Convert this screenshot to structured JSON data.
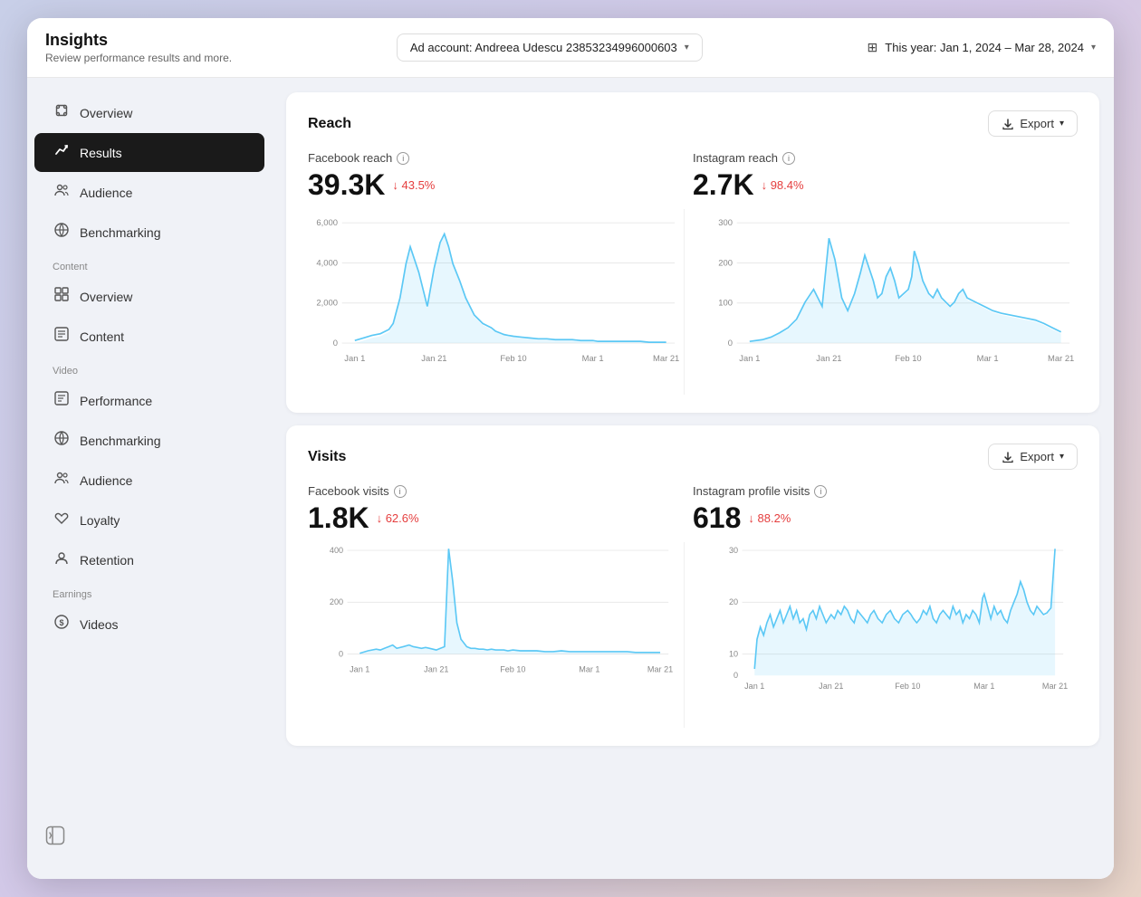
{
  "app": {
    "title": "Insights",
    "subtitle": "Review performance results and more."
  },
  "adAccount": {
    "label": "Ad account: Andreea Udescu 23853234996000603",
    "chevron": "▾"
  },
  "dateRange": {
    "label": "This year: Jan 1, 2024 – Mar 28, 2024",
    "chevron": "▾"
  },
  "sidebar": {
    "items": [
      {
        "id": "overview",
        "label": "Overview",
        "icon": "❊"
      },
      {
        "id": "results",
        "label": "Results",
        "icon": "↗",
        "active": true
      },
      {
        "id": "audience",
        "label": "Audience",
        "icon": "👥"
      },
      {
        "id": "benchmarking",
        "label": "Benchmarking",
        "icon": "⚖"
      }
    ],
    "contentSection": "Content",
    "contentItems": [
      {
        "id": "content-overview",
        "label": "Overview",
        "icon": "▦"
      },
      {
        "id": "content-content",
        "label": "Content",
        "icon": "☰"
      }
    ],
    "videoSection": "Video",
    "videoItems": [
      {
        "id": "video-performance",
        "label": "Performance",
        "icon": "▤"
      },
      {
        "id": "video-benchmarking",
        "label": "Benchmarking",
        "icon": "⚖"
      },
      {
        "id": "video-audience",
        "label": "Audience",
        "icon": "👥"
      },
      {
        "id": "video-loyalty",
        "label": "Loyalty",
        "icon": "🛡"
      },
      {
        "id": "video-retention",
        "label": "Retention",
        "icon": "👤"
      }
    ],
    "earningsSection": "Earnings",
    "earningsItems": [
      {
        "id": "earnings-videos",
        "label": "Videos",
        "icon": "💲"
      }
    ],
    "bottomIcon": "⊞"
  },
  "reach": {
    "cardTitle": "Reach",
    "exportLabel": "Export",
    "facebook": {
      "label": "Facebook reach",
      "value": "39.3K",
      "change": "↓ 43.5%",
      "changeDir": "down"
    },
    "instagram": {
      "label": "Instagram reach",
      "value": "2.7K",
      "change": "↓ 98.4%",
      "changeDir": "down"
    },
    "fbChart": {
      "yLabels": [
        "6,000",
        "4,000",
        "2,000",
        "0"
      ],
      "xLabels": [
        "Jan 1",
        "Jan 21",
        "Feb 10",
        "Mar 1",
        "Mar 21"
      ]
    },
    "igChart": {
      "yLabels": [
        "300",
        "200",
        "100",
        "0"
      ],
      "xLabels": [
        "Jan 1",
        "Jan 21",
        "Feb 10",
        "Mar 1",
        "Mar 21"
      ]
    }
  },
  "visits": {
    "cardTitle": "Visits",
    "exportLabel": "Export",
    "facebook": {
      "label": "Facebook visits",
      "value": "1.8K",
      "change": "↓ 62.6%",
      "changeDir": "down"
    },
    "instagram": {
      "label": "Instagram profile visits",
      "value": "618",
      "change": "↓ 88.2%",
      "changeDir": "down"
    },
    "fbChart": {
      "yLabels": [
        "400",
        "200",
        "0"
      ],
      "xLabels": [
        "Jan 1",
        "Jan 21",
        "Feb 10",
        "Mar 1",
        "Mar 21"
      ]
    },
    "igChart": {
      "yLabels": [
        "30",
        "20",
        "10",
        "0"
      ],
      "xLabels": [
        "Jan 1",
        "Jan 21",
        "Feb 10",
        "Mar 1",
        "Mar 21"
      ]
    }
  }
}
